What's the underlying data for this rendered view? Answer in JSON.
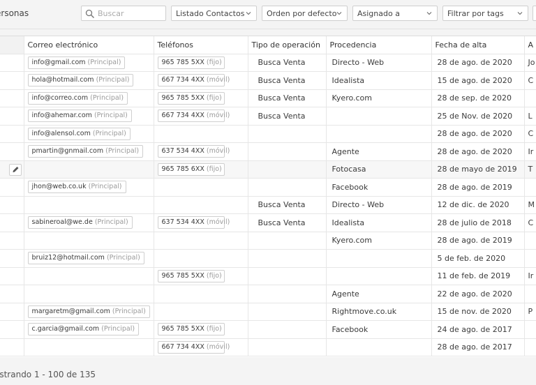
{
  "toolbar": {
    "section_label": "ersonas",
    "search_placeholder": "Buscar",
    "filters": [
      {
        "label": "Listado Contactos"
      },
      {
        "label": "Orden por defecto"
      },
      {
        "label": "Asignado a"
      },
      {
        "label": "Filtrar por tags"
      }
    ]
  },
  "table": {
    "columns": [
      "",
      "Correo electrónico",
      "Teléfonos",
      "Tipo de operación",
      "Procedencia",
      "Fecha de alta",
      "A"
    ],
    "rows": [
      {
        "email": "info@gmail.com",
        "email_tag": "(Principal)",
        "phone": "965 785 5XX",
        "phone_tag": "(fijo)",
        "op": "Busca Venta",
        "source": "Directo - Web",
        "date": "28 de ago. de 2020",
        "extra": "Jo"
      },
      {
        "email": "hola@hotmail.com",
        "email_tag": "(Principal)",
        "phone": "667 734 4XX",
        "phone_tag": "(móvil)",
        "op": "Busca Venta",
        "source": "Idealista",
        "date": "15 de ago. de 2020",
        "extra": "C"
      },
      {
        "email": "info@correo.com",
        "email_tag": "(Principal)",
        "phone": "965 785 5XX",
        "phone_tag": "(fijo)",
        "op": "Busca Venta",
        "source": "Kyero.com",
        "date": "28 de sep. de 2020",
        "extra": ""
      },
      {
        "email": "info@ahemar.com",
        "email_tag": "(Principal)",
        "phone": "667 734 4XX",
        "phone_tag": "(móvil)",
        "op": "Busca Venta",
        "source": "",
        "date": "25 de Nov. de 2020",
        "extra": "L"
      },
      {
        "email": "info@alensol.com",
        "email_tag": "(Principal)",
        "phone": "",
        "phone_tag": "",
        "op": "",
        "source": "",
        "date": "28 de ago. de 2020",
        "extra": "C"
      },
      {
        "email": "pmartin@gnmail.com",
        "email_tag": "(Principal)",
        "phone": "637 534 4XX",
        "phone_tag": "(móvil)",
        "op": "",
        "source": "Agente",
        "date": "28 de ago. de 2020",
        "extra": "Ir"
      },
      {
        "email": "",
        "email_tag": "",
        "phone": "965 785 6XX",
        "phone_tag": "(fijo)",
        "op": "",
        "source": "Fotocasa",
        "date": "28 de mayo de 2019",
        "extra": "T",
        "highlight": true
      },
      {
        "email": "jhon@web.co.uk",
        "email_tag": "(Principal)",
        "phone": "",
        "phone_tag": "",
        "op": "",
        "source": "Facebook",
        "date": "28 de ago. de 2019",
        "extra": ""
      },
      {
        "email": "",
        "email_tag": "",
        "phone": "",
        "phone_tag": "",
        "op": "Busca Venta",
        "source": "Directo - Web",
        "date": "12 de dic. de 2020",
        "extra": "M"
      },
      {
        "email": "sabineroal@we.de",
        "email_tag": "(Principal)",
        "phone": "637 534 4XX",
        "phone_tag": "(móvil)",
        "op": "Busca Venta",
        "source": "Idealista",
        "date": "28 de julio de 2018",
        "extra": "C"
      },
      {
        "email": "",
        "email_tag": "",
        "phone": "",
        "phone_tag": "",
        "op": "",
        "source": "Kyero.com",
        "date": "28 de ago. de 2019",
        "extra": ""
      },
      {
        "email": "bruiz12@hotmail.com",
        "email_tag": "(Principal)",
        "phone": "",
        "phone_tag": "",
        "op": "",
        "source": "",
        "date": "5 de feb. de 2020",
        "extra": ""
      },
      {
        "email": "",
        "email_tag": "",
        "phone": "965 785 5XX",
        "phone_tag": "(fijo)",
        "op": "",
        "source": "",
        "date": "11 de feb. de 2019",
        "extra": "Ir"
      },
      {
        "email": "",
        "email_tag": "",
        "phone": "",
        "phone_tag": "",
        "op": "",
        "source": "Agente",
        "date": "22 de ago. de 2020",
        "extra": ""
      },
      {
        "email": "margaretm@gmail.com",
        "email_tag": "(Principal)",
        "phone": "",
        "phone_tag": "",
        "op": "",
        "source": "Rightmove.co.uk",
        "date": "15 de nov. de 2020",
        "extra": "P"
      },
      {
        "email": "c.garcia@gmail.com",
        "email_tag": "(Principal)",
        "phone": "965 785 5XX",
        "phone_tag": "(fijo)",
        "op": "",
        "source": "Facebook",
        "date": "24 de ago. de 2017",
        "extra": ""
      },
      {
        "email": "",
        "email_tag": "",
        "phone": "667 734 4XX",
        "phone_tag": "(móvil)",
        "op": "",
        "source": "",
        "date": "28 de ago. de 2017",
        "extra": ""
      }
    ]
  },
  "footer": {
    "pagination_text": "ostrando 1 - 100 de 135"
  },
  "icons": {
    "search": "search-icon",
    "caret": "chevron-down-icon",
    "edit": "pencil-icon"
  }
}
